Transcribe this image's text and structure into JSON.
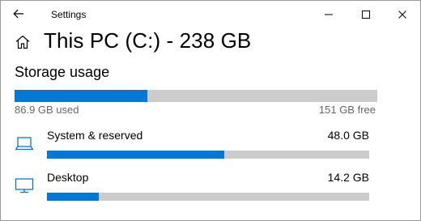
{
  "window": {
    "title": "Settings",
    "back_icon": "arrow-left-icon",
    "controls": [
      "minimize-icon",
      "maximize-icon",
      "close-icon"
    ]
  },
  "header": {
    "home_icon": "home-icon",
    "title": "This PC (C:) - 238 GB"
  },
  "storage": {
    "section_title": "Storage usage",
    "used_label": "86.9 GB used",
    "free_label": "151 GB free",
    "used_fraction": 0.365,
    "bar_color": "#0078d7",
    "track_color": "#cccccc"
  },
  "categories": [
    {
      "icon": "laptop-icon",
      "name": "System & reserved",
      "size": "48.0 GB",
      "fraction": 0.55
    },
    {
      "icon": "monitor-icon",
      "name": "Desktop",
      "size": "14.2 GB",
      "fraction": 0.16
    }
  ],
  "colors": {
    "accent": "#0078d7",
    "secondary_text": "#666666"
  }
}
